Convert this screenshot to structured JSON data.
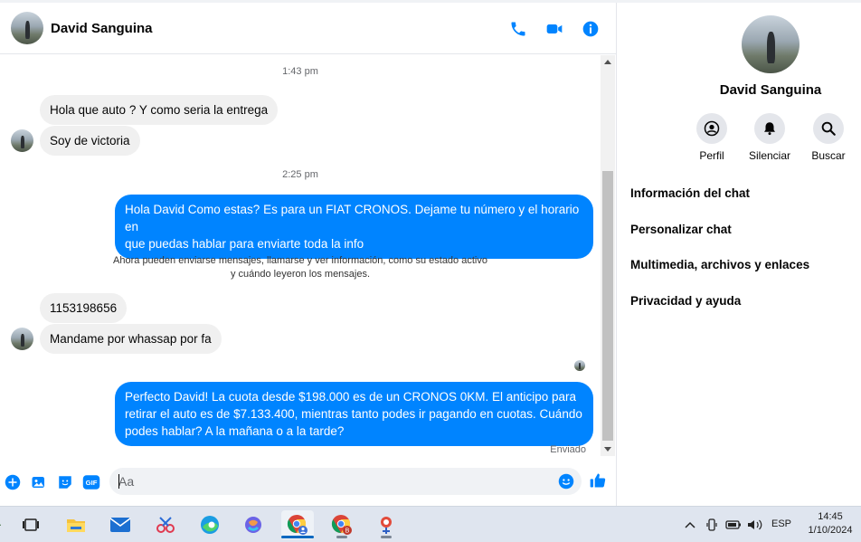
{
  "header": {
    "contact_name": "David Sanguina"
  },
  "messages": {
    "time1": "1:43 pm",
    "in1": "Hola que auto ? Y como seria la entrega",
    "in2": "Soy de victoria",
    "time2": "2:25 pm",
    "out1_line1": "Hola David Como estas? Es para un FIAT CRONOS. Dejame tu número y el horario en",
    "out1_line2": "que puedas hablar para enviarte toda la info",
    "notice_line1": "Ahora pueden enviarse mensajes, llamarse y ver información, como su estado activo",
    "notice_line2": "y cuándo leyeron los mensajes.",
    "in3": "1153198656",
    "in4": "Mandame por whassap por fa",
    "out2_line1": "Perfecto David!  La cuota desde $198.000 es de un CRONOS 0KM. El anticipo para",
    "out2_line2": "retirar el auto es de $7.133.400, mientras tanto podes ir pagando en cuotas. Cuándo",
    "out2_line3": "podes hablar? A la mañana o a la tarde?",
    "sent_status": "Enviado"
  },
  "composer": {
    "placeholder": "Aa"
  },
  "side_panel": {
    "name": "David Sanguina",
    "actions": [
      {
        "label": "Perfil",
        "icon": "profile-icon"
      },
      {
        "label": "Silenciar",
        "icon": "bell-icon"
      },
      {
        "label": "Buscar",
        "icon": "search-icon"
      }
    ],
    "menu": [
      "Información del chat",
      "Personalizar chat",
      "Multimedia, archivos y enlaces",
      "Privacidad y ayuda"
    ]
  },
  "taskbar": {
    "language": "ESP",
    "time": "14:45",
    "date": "1/10/2024"
  },
  "colors": {
    "accent": "#0084ff",
    "incoming_bubble": "#f0f0f0"
  }
}
